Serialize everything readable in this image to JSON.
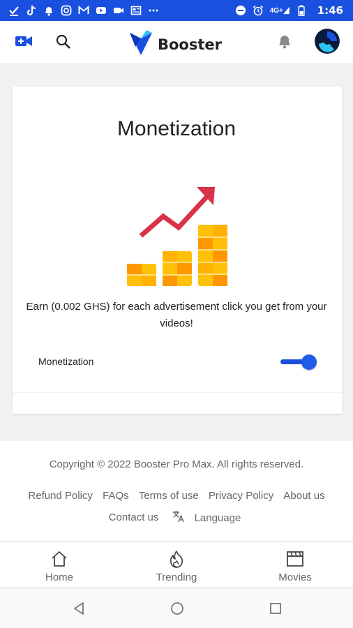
{
  "status_bar": {
    "time": "1:46",
    "network": "4G+"
  },
  "header": {
    "logo_text": "Booster"
  },
  "monetization": {
    "title": "Monetization",
    "description": "Earn (0.002 GHS) for each advertisement click you get from your videos!",
    "toggle_label": "Monetization",
    "toggle_on": true
  },
  "footer": {
    "copyright": "Copyright © 2022 Booster Pro Max. All rights reserved.",
    "links": [
      "Refund Policy",
      "FAQs",
      "Terms of use",
      "Privacy Policy",
      "About us"
    ],
    "contact": "Contact us",
    "language": "Language"
  },
  "bottom_nav": {
    "home": "Home",
    "trending": "Trending",
    "movies": "Movies"
  },
  "colors": {
    "accent": "#1a50e0",
    "arrow": "#d8314a",
    "coin_yellow": "#ffc107",
    "coin_orange": "#ff9800"
  }
}
